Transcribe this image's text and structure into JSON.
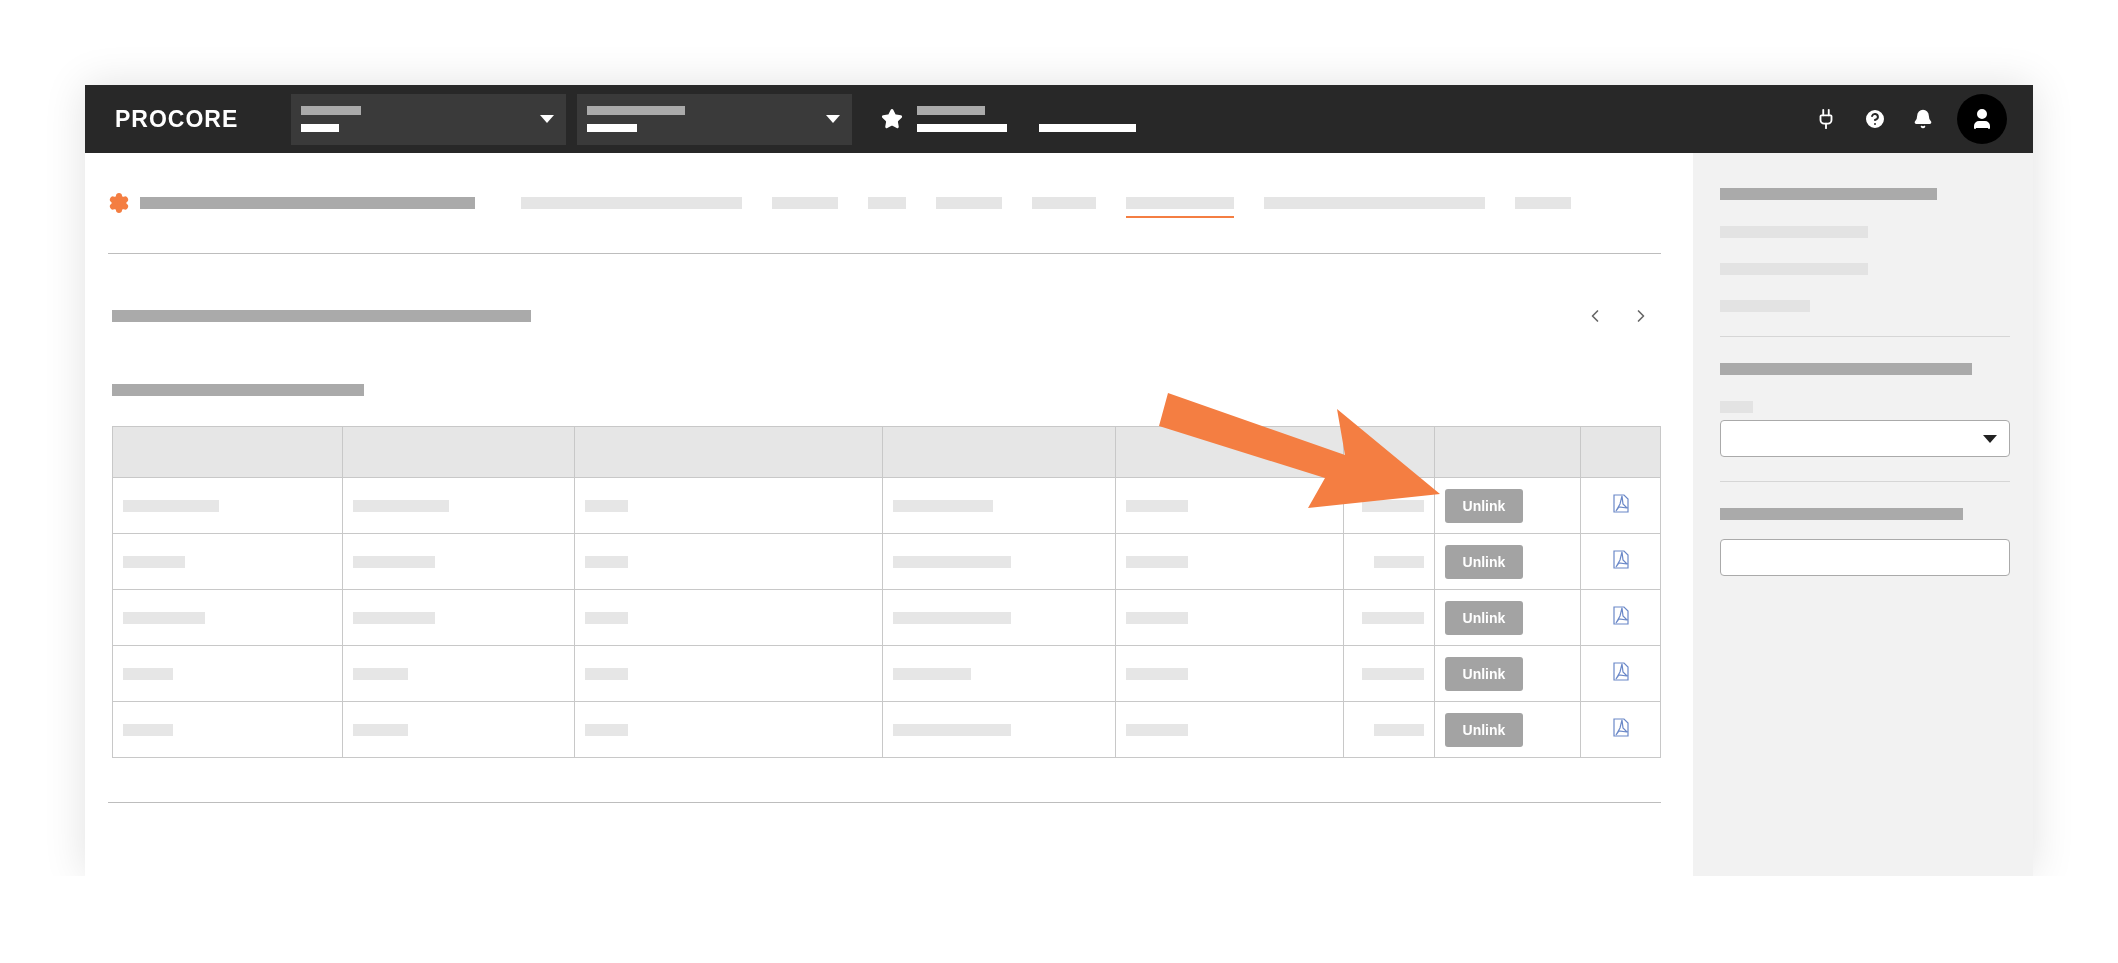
{
  "header": {
    "logo": "PROCORE"
  },
  "tabs": [
    {
      "selected": false
    },
    {
      "selected": false
    },
    {
      "selected": false
    },
    {
      "selected": false
    },
    {
      "selected": false
    },
    {
      "selected": true
    },
    {
      "selected": false
    },
    {
      "selected": false
    }
  ],
  "table": {
    "rows": [
      {
        "action": "Unlink"
      },
      {
        "action": "Unlink"
      },
      {
        "action": "Unlink"
      },
      {
        "action": "Unlink"
      },
      {
        "action": "Unlink"
      }
    ]
  }
}
